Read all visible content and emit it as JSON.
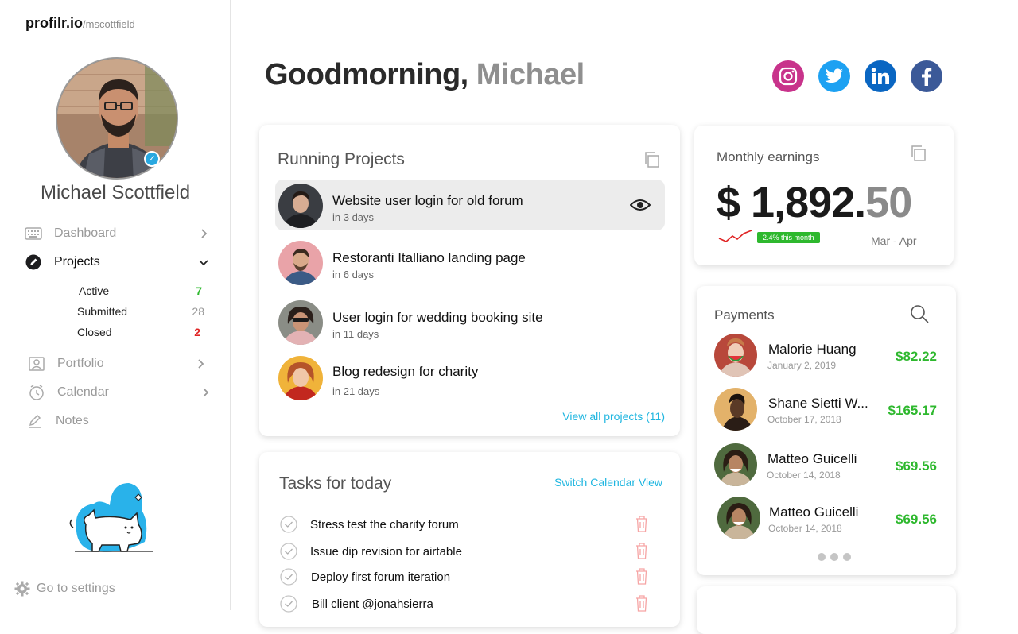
{
  "brand": {
    "name": "profilr.io",
    "handle": "/mscottfield"
  },
  "profile": {
    "name": "Michael Scottfield"
  },
  "nav": {
    "dashboard": "Dashboard",
    "projects": "Projects",
    "sub": [
      {
        "label": "Active",
        "count": "7"
      },
      {
        "label": "Submitted",
        "count": "28"
      },
      {
        "label": "Closed",
        "count": "2"
      }
    ],
    "portfolio": "Portfolio",
    "calendar": "Calendar",
    "notes": "Notes"
  },
  "settings": "Go to settings",
  "greeting": {
    "prefix": "Goodmorning,",
    "name": "Michael"
  },
  "social": [
    "instagram-icon",
    "twitter-icon",
    "linkedin-icon",
    "facebook-icon"
  ],
  "colors": {
    "accent": "#1fb6e0",
    "green": "#2eb82e",
    "red": "#e02424",
    "instagram": "#c13584",
    "twitter": "#1da1f2",
    "linkedin": "#0a66c2",
    "facebook": "#3b5998"
  },
  "running_projects": {
    "title": "Running Projects",
    "items": [
      {
        "title": "Website user login for old forum",
        "due": "in 3 days"
      },
      {
        "title": "Restoranti Italliano landing page",
        "due": "in 6 days"
      },
      {
        "title": "User login for wedding booking site",
        "due": "in 11 days"
      },
      {
        "title": "Blog redesign for charity",
        "due": "in 21 days"
      }
    ],
    "view_all": "View all projects (11)"
  },
  "tasks": {
    "title": "Tasks for today",
    "switch": "Switch Calendar View",
    "items": [
      "Stress test the charity forum",
      "Issue dip revision for airtable",
      "Deploy first forum iteration",
      "Bill client @jonahsierra"
    ]
  },
  "earnings": {
    "title": "Monthly earnings",
    "amount_main": "$ 1,892.",
    "amount_cents": "50",
    "trend": "2.4% this month",
    "period": "Mar - Apr"
  },
  "payments": {
    "title": "Payments",
    "items": [
      {
        "name": "Malorie Huang",
        "date": "January 2, 2019",
        "amount": "$82.22"
      },
      {
        "name": "Shane Sietti W...",
        "date": "October 17, 2018",
        "amount": "$165.17"
      },
      {
        "name": "Matteo Guicelli",
        "date": "October 14, 2018",
        "amount": "$69.56"
      },
      {
        "name": "Matteo Guicelli",
        "date": "October 14, 2018",
        "amount": "$69.56"
      }
    ]
  }
}
